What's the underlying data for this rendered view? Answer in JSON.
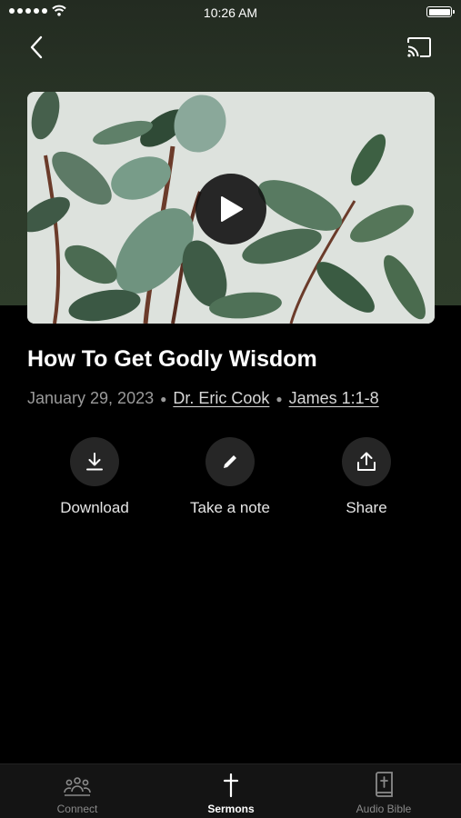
{
  "status_bar": {
    "time": "10:26 AM",
    "signal_bars": 5,
    "battery_level": 1.0
  },
  "header": {
    "back_icon": "chevron-left-icon",
    "cast_icon": "cast-icon"
  },
  "media": {
    "thumbnail": "rubber plant leaves photo",
    "play_icon": "play-icon"
  },
  "sermon": {
    "title": "How To Get Godly Wisdom",
    "date": "January 29, 2023",
    "speaker": "Dr. Eric Cook",
    "scripture": "James 1:1-8"
  },
  "actions": [
    {
      "label": "Download",
      "icon": "download-icon"
    },
    {
      "label": "Take a note",
      "icon": "pencil-icon"
    },
    {
      "label": "Share",
      "icon": "share-icon"
    }
  ],
  "tabbar": {
    "items": [
      {
        "label": "Connect",
        "icon": "people-icon",
        "active": false
      },
      {
        "label": "Sermons",
        "icon": "cross-icon",
        "active": true
      },
      {
        "label": "Audio Bible",
        "icon": "bible-icon",
        "active": false
      }
    ]
  },
  "colors": {
    "background": "#000000",
    "hero": "#2c3a29",
    "action_circle": "#262626",
    "tabbar": "#141414"
  }
}
